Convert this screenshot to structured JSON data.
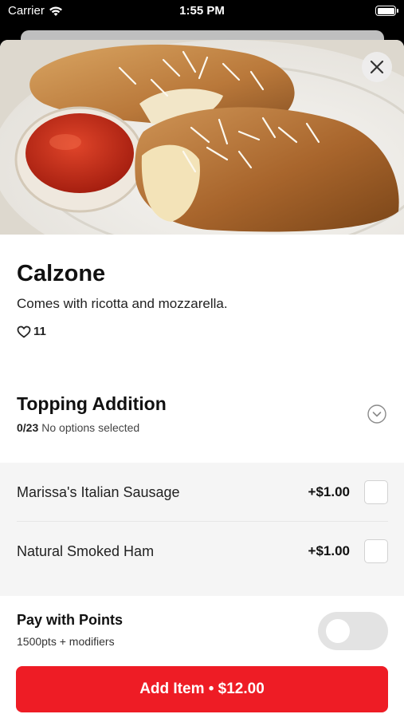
{
  "status_bar": {
    "carrier": "Carrier",
    "time": "1:55 PM"
  },
  "item": {
    "name": "Calzone",
    "description": "Comes with ricotta and mozzarella.",
    "likes": "11"
  },
  "modifier_group": {
    "title": "Topping Addition",
    "count": "0/23",
    "status": "No options selected",
    "options": [
      {
        "name": "Marissa's Italian Sausage",
        "price": "+$1.00"
      },
      {
        "name": "Natural Smoked Ham",
        "price": "+$1.00"
      }
    ]
  },
  "pay_with_points": {
    "title": "Pay with Points",
    "subtitle": "1500pts + modifiers",
    "enabled": false
  },
  "add_button": {
    "label": "Add Item • $12.00"
  },
  "colors": {
    "accent": "#ee1c25",
    "toggle_off": "#e3e3e3"
  }
}
